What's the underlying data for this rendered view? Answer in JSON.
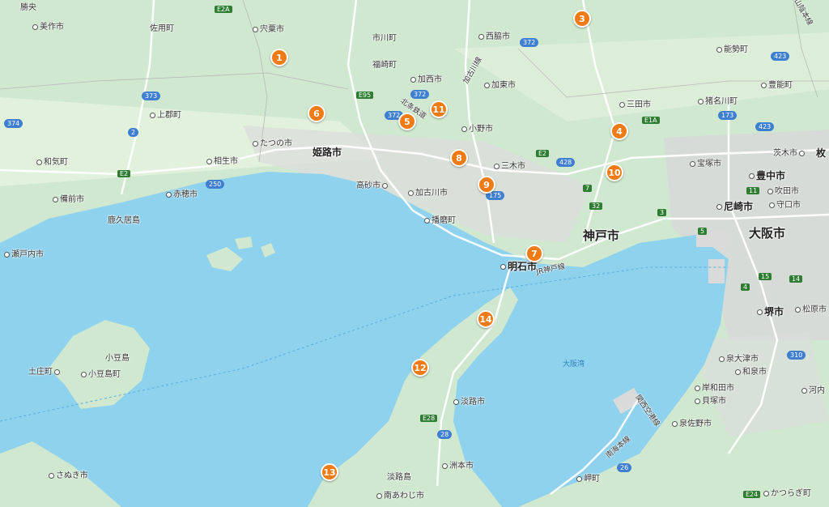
{
  "colors": {
    "land": "#cfe8cf",
    "land_light": "#e2f1dc",
    "water": "#8fd2ee",
    "urban": "#dadada",
    "marker": "#f07a13",
    "road": "#ffffff"
  },
  "cities": {
    "himeji": "姫路市",
    "kobe": "神戸市",
    "osaka": "大阪市",
    "akashi": "明石市",
    "sakai": "堺市",
    "toyonaka": "豊中市",
    "amagasaki": "尼崎市"
  },
  "labels": {
    "mimasaka": "美作市",
    "sayo": "佐用町",
    "shiso": "宍粟市",
    "ichikawa": "市川町",
    "fukusaki": "福崎町",
    "kasai": "加西市",
    "nishiwaki": "西脇市",
    "kato": "加東市",
    "ono": "小野市",
    "miki": "三木市",
    "kakogawa": "加古川市",
    "harima": "播磨町",
    "takasago": "高砂市",
    "tatsuno": "たつの市",
    "aioi": "相生市",
    "ako": "赤穂市",
    "kamigori": "上郡町",
    "wake": "和気町",
    "bizen": "備前市",
    "setouchi": "瀬戸内市",
    "sanda": "三田市",
    "nose": "能勢町",
    "toyono": "豊能町",
    "inagawa": "猪名川町",
    "takarazuka": "宝塚市",
    "ibaraki": "茨木市",
    "suita": "吹田市",
    "moriguchi": "守口市",
    "matsubara": "松原市",
    "izumiotsu": "泉大津市",
    "izumi": "和泉市",
    "kishiwada": "岸和田市",
    "kaizuka": "貝塚市",
    "izumisano": "泉佐野市",
    "kawachi": "河内",
    "katsuragi": "かつらぎ町",
    "misaki": "岬町",
    "awaji": "淡路市",
    "sumoto": "洲本市",
    "awajishima": "淡路島",
    "minamiawaji": "南あわじ市",
    "shodoshima_island": "小豆島",
    "shodoshima_town": "小豆島町",
    "tonosho": "土庄町",
    "sanuki": "さぬき市",
    "kasaoka_island": "鹿久居島",
    "osaka_bay": "大阪湾",
    "jr_kobe": "JR神戸線",
    "hokujo": "北条鉄道",
    "kakogawa_line": "加古川線",
    "kansai_airport": "関西空港線",
    "nankai": "南海本線",
    "fukuchiyama": "山陰本線",
    "partial_kanji": "枚",
    "top_left": "勝央"
  },
  "shields": {
    "e2a_top": "E2A",
    "e95": "E95",
    "e2_left": "E2",
    "e2_mid": "E2",
    "e1a": "E1A",
    "e28": "E28",
    "e24": "E24",
    "n7": "7",
    "n32": "32",
    "n3": "3",
    "n5": "5",
    "n11": "11",
    "n15": "15",
    "n14": "14",
    "n4": "4"
  },
  "routes": {
    "r373": "373",
    "r374": "374",
    "r2": "2",
    "r250": "250",
    "r372_top": "372",
    "r372_a": "372",
    "r372_b": "372",
    "r175": "175",
    "r428": "428",
    "r173": "173",
    "r423_a": "423",
    "r423_b": "423",
    "r310": "310",
    "r26": "26",
    "r28": "28"
  },
  "markers": [
    "1",
    "3",
    "4",
    "5",
    "6",
    "7",
    "8",
    "9",
    "10",
    "11",
    "12",
    "13",
    "14"
  ]
}
